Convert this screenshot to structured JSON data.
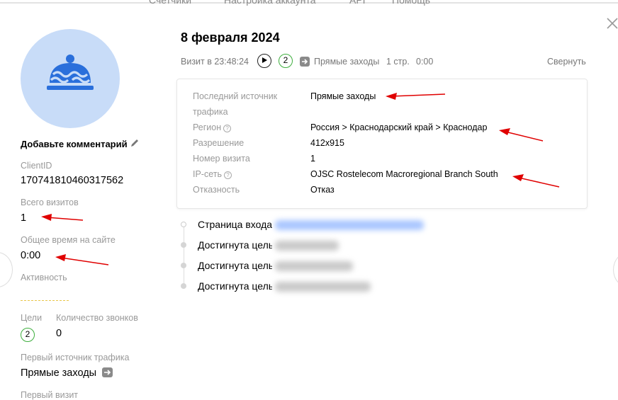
{
  "top_nav": [
    "Счетчики",
    "Настройка аккаунта",
    "API",
    "Помощь"
  ],
  "left": {
    "add_comment": "Добавьте комментарий",
    "client_id_label": "ClientID",
    "client_id_value": "170741810460317562",
    "total_visits_label": "Всего визитов",
    "total_visits_value": "1",
    "total_time_label": "Общее время на сайте",
    "total_time_value": "0:00",
    "activity_label": "Активность",
    "goals_label": "Цели",
    "goals_value": "2",
    "calls_label": "Количество звонков",
    "calls_value": "0",
    "first_source_label": "Первый источник трафика",
    "first_source_value": "Прямые заходы",
    "first_visit_label": "Первый визит"
  },
  "visit": {
    "date": "8 февраля 2024",
    "time": "Визит в 23:48:24",
    "goals": "2",
    "source": "Прямые заходы",
    "pages": "1 стр.",
    "duration": "0:00",
    "collapse": "Свернуть"
  },
  "details": {
    "last_source_label_1": "Последний источник",
    "last_source_label_2": "трафика",
    "last_source_value": "Прямые заходы",
    "region_label": "Регион",
    "region_value": "Россия > Краснодарский край > Краснодар",
    "resolution_label": "Разрешение",
    "resolution_value": "412x915",
    "visit_number_label": "Номер визита",
    "visit_number_value": "1",
    "ip_label": "IP-сеть",
    "ip_value": "OJSC Rostelecom Macroregional Branch South",
    "bounce_label": "Отказность",
    "bounce_value": "Отказ"
  },
  "timeline": [
    "Страница входа",
    "Достигнута цель",
    "Достигнута цель",
    "Достигнута цель"
  ],
  "colors": {
    "avatar_bg": "#c8dcf8",
    "icon_blue": "#2a6fdb",
    "goal_green": "#3eae3e",
    "annotation_red": "#e00000",
    "accent_yellow": "#e8c64a"
  }
}
